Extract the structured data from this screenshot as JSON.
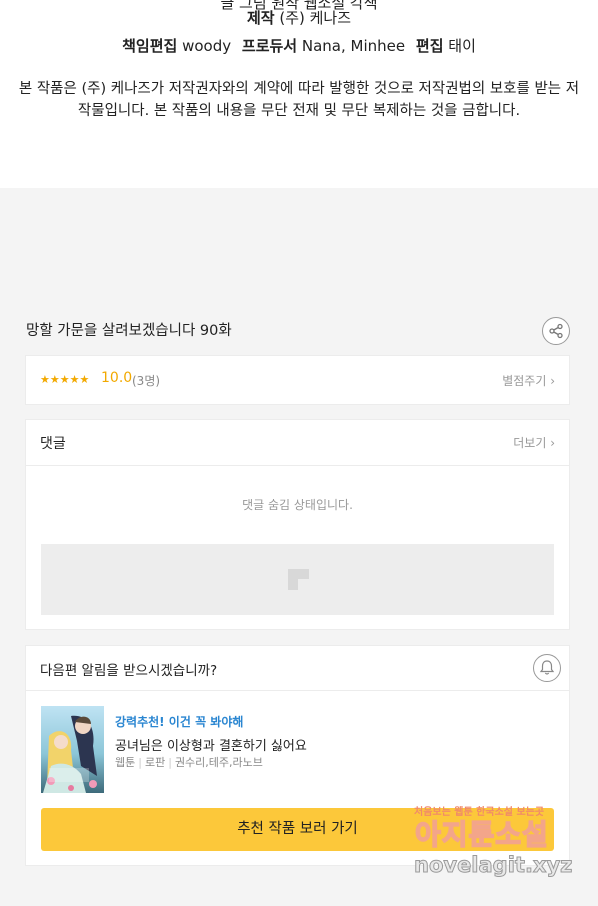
{
  "credits": {
    "cut_line": "글  그림  원작 웹소설  각색",
    "production_label": "제작",
    "production_value": "(주) 케나즈",
    "editor_label": "책임편집",
    "editor_value": "woody",
    "producer_label": "프로듀서",
    "producer_value": "Nana, Minhee",
    "edit_label": "편집",
    "edit_value": "태이",
    "notice": "본 작품은 (주) 케나즈가 저작권자와의 계약에 따라 발행한 것으로 저작권법의 보호를 받는 저작물입니다. 본 작품의 내용을 무단 전재 및 무단 복제하는 것을 금합니다."
  },
  "episode": {
    "title": "망할 가문을 살려보겠습니다 90화",
    "share_icon": "share-icon"
  },
  "rating": {
    "stars": "★★★★★",
    "score": "10.0",
    "count": "(3명)",
    "rate_link": "별점주기 ›",
    "star_color": "#f2a900"
  },
  "comments": {
    "title": "댓글",
    "more_link": "더보기 ›",
    "hidden_message": "댓글 숨김 상태입니다."
  },
  "notify": {
    "question": "다음편 알림을 받으시겠습니까?",
    "bell_icon": "bell-icon"
  },
  "recommend": {
    "tag": "강력추천! 이건 꼭 봐야해",
    "title": "공녀님은 이상형과 결혼하기 싫어요",
    "genre": "웹툰",
    "category": "로판",
    "authors": "권수리,테주,라노브",
    "tag_color": "#2a86d1",
    "cta_label": "추천 작품 보러 가기",
    "cta_color": "#fcc83a"
  },
  "watermark": {
    "top": "처음보는 웹툰 한국소설 보는곳",
    "middle": "아지툰소설",
    "bottom": "novelagit.xyz"
  }
}
